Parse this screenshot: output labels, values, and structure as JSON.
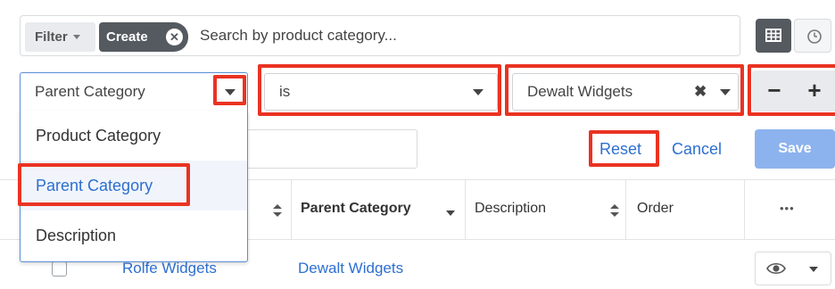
{
  "filter_bar": {
    "filter_label": "Filter",
    "create_pill_label": "Create",
    "search_placeholder": "Search by product category..."
  },
  "filter_row": {
    "field_select_value": "Parent Category",
    "operator_select_value": "is",
    "value_select_value": "Dewalt Widgets",
    "minus_label": "−",
    "plus_label": "+"
  },
  "field_dropdown": {
    "options": [
      "Product Category",
      "Parent Category",
      "Description"
    ],
    "selected": "Parent Category"
  },
  "actions": {
    "reset_label": "Reset",
    "cancel_label": "Cancel",
    "save_label": "Save"
  },
  "table": {
    "columns": [
      "Parent Category",
      "Description",
      "Order"
    ],
    "more_label": "•••",
    "rows": [
      {
        "name": "Rolfe Widgets",
        "parent_category": "Dewalt Widgets"
      }
    ]
  },
  "colors": {
    "highlight_box": "#ea3323",
    "link": "#2d6fd1",
    "save_button": "#8cb3ee",
    "dark_button": "#555a60"
  }
}
